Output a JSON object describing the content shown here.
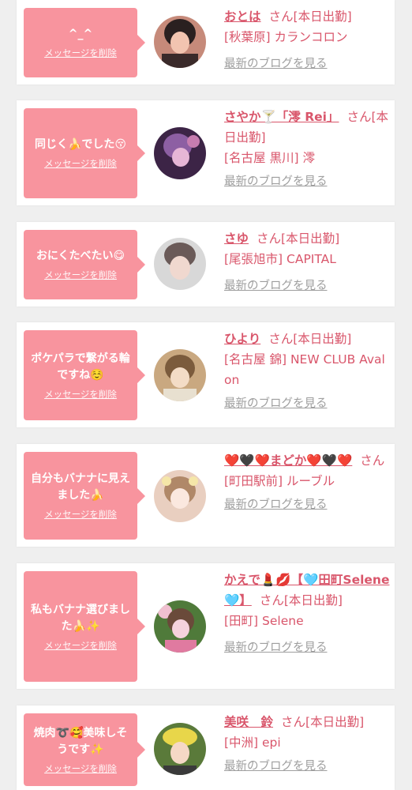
{
  "delete_label": "メッセージを削除",
  "blog_label": "最新のブログを見る",
  "honorific": "さん",
  "entries": [
    {
      "message": "^_^",
      "name": "おとは",
      "status": "[本日出勤]",
      "shop": "[秋葉原] カランコロン",
      "avatar_colors": [
        "#2a2020",
        "#c68a7a",
        "#f2c4b0"
      ]
    },
    {
      "message": "同じく🍌でした😚",
      "name": "さやか🍸「澪 Rei」",
      "status": "[本日出勤]",
      "shop": "[名古屋 黒川] 澪",
      "avatar_colors": [
        "#3c2446",
        "#8d5fa3",
        "#e6b6d6"
      ]
    },
    {
      "message": "おにくたべたい😋",
      "name": "さゆ",
      "status": "[本日出勤]",
      "shop": "[尾張旭市] CAPITAL",
      "avatar_colors": [
        "#d8d8d8",
        "#6a5a58",
        "#f0d8cf"
      ]
    },
    {
      "message": "ポケパラで繋がる輪ですね☺️",
      "name": "ひより",
      "status": "[本日出勤]",
      "shop": "[名古屋 錦] NEW CLUB Avalon",
      "avatar_colors": [
        "#7b5b3c",
        "#c9a880",
        "#f3dcc6"
      ]
    },
    {
      "message": "自分もバナナに見えました🍌",
      "name": "❤️🖤❤️まどか❤️🖤❤️",
      "status": "",
      "shop": "[町田駅前] ルーブル",
      "avatar_colors": [
        "#e9cfc0",
        "#b08868",
        "#fbe8df"
      ]
    },
    {
      "message": "私もバナナ選びました🍌✨",
      "name": "かえで💄💋【🩵田町Selene🩵】",
      "status": "[本日出勤]",
      "shop": "[田町] Selene",
      "avatar_colors": [
        "#4f7a3a",
        "#e07aa0",
        "#f5d2dc"
      ]
    },
    {
      "message": "焼肉➰🥰美味しそうです✨",
      "name": "美咲　鈴",
      "status": "[本日出勤]",
      "shop": "[中洲] epi",
      "avatar_colors": [
        "#e8d64a",
        "#5a7a3a",
        "#f5d8c6"
      ]
    }
  ]
}
